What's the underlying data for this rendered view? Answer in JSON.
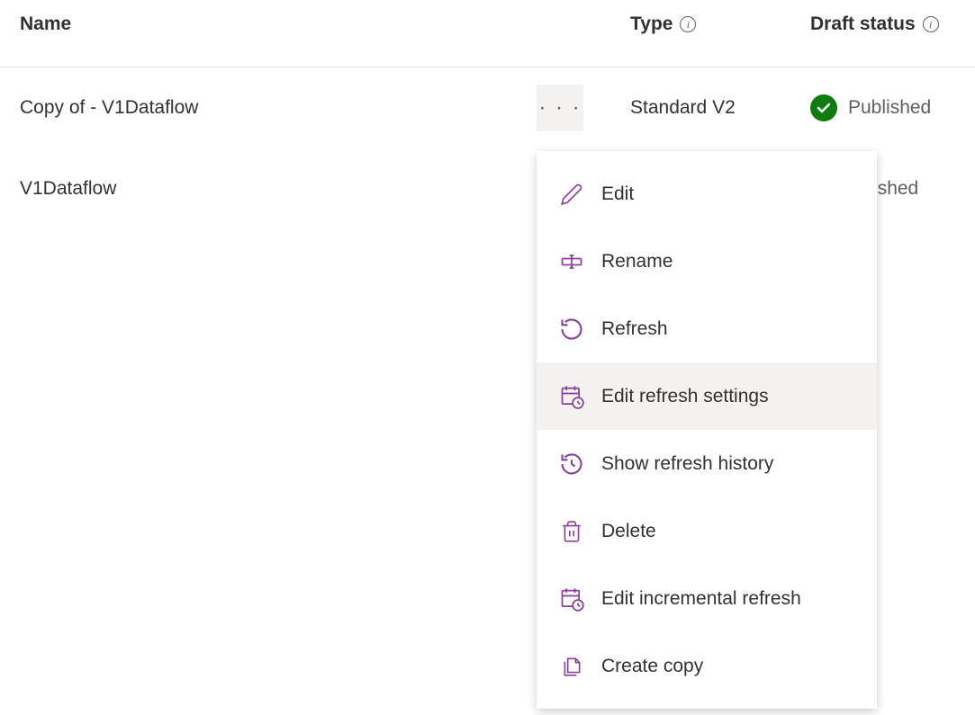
{
  "headers": {
    "name": "Name",
    "type": "Type",
    "status": "Draft status"
  },
  "rows": [
    {
      "name": "Copy of - V1Dataflow",
      "type": "Standard V2",
      "status": "Published"
    },
    {
      "name": "V1Dataflow",
      "type": "",
      "status": "ublished"
    }
  ],
  "menu": {
    "items": [
      {
        "label": "Edit",
        "icon": "edit"
      },
      {
        "label": "Rename",
        "icon": "rename"
      },
      {
        "label": "Refresh",
        "icon": "refresh"
      },
      {
        "label": "Edit refresh settings",
        "icon": "schedule"
      },
      {
        "label": "Show refresh history",
        "icon": "history"
      },
      {
        "label": "Delete",
        "icon": "delete"
      },
      {
        "label": "Edit incremental refresh",
        "icon": "schedule"
      },
      {
        "label": "Create copy",
        "icon": "copy"
      }
    ]
  }
}
